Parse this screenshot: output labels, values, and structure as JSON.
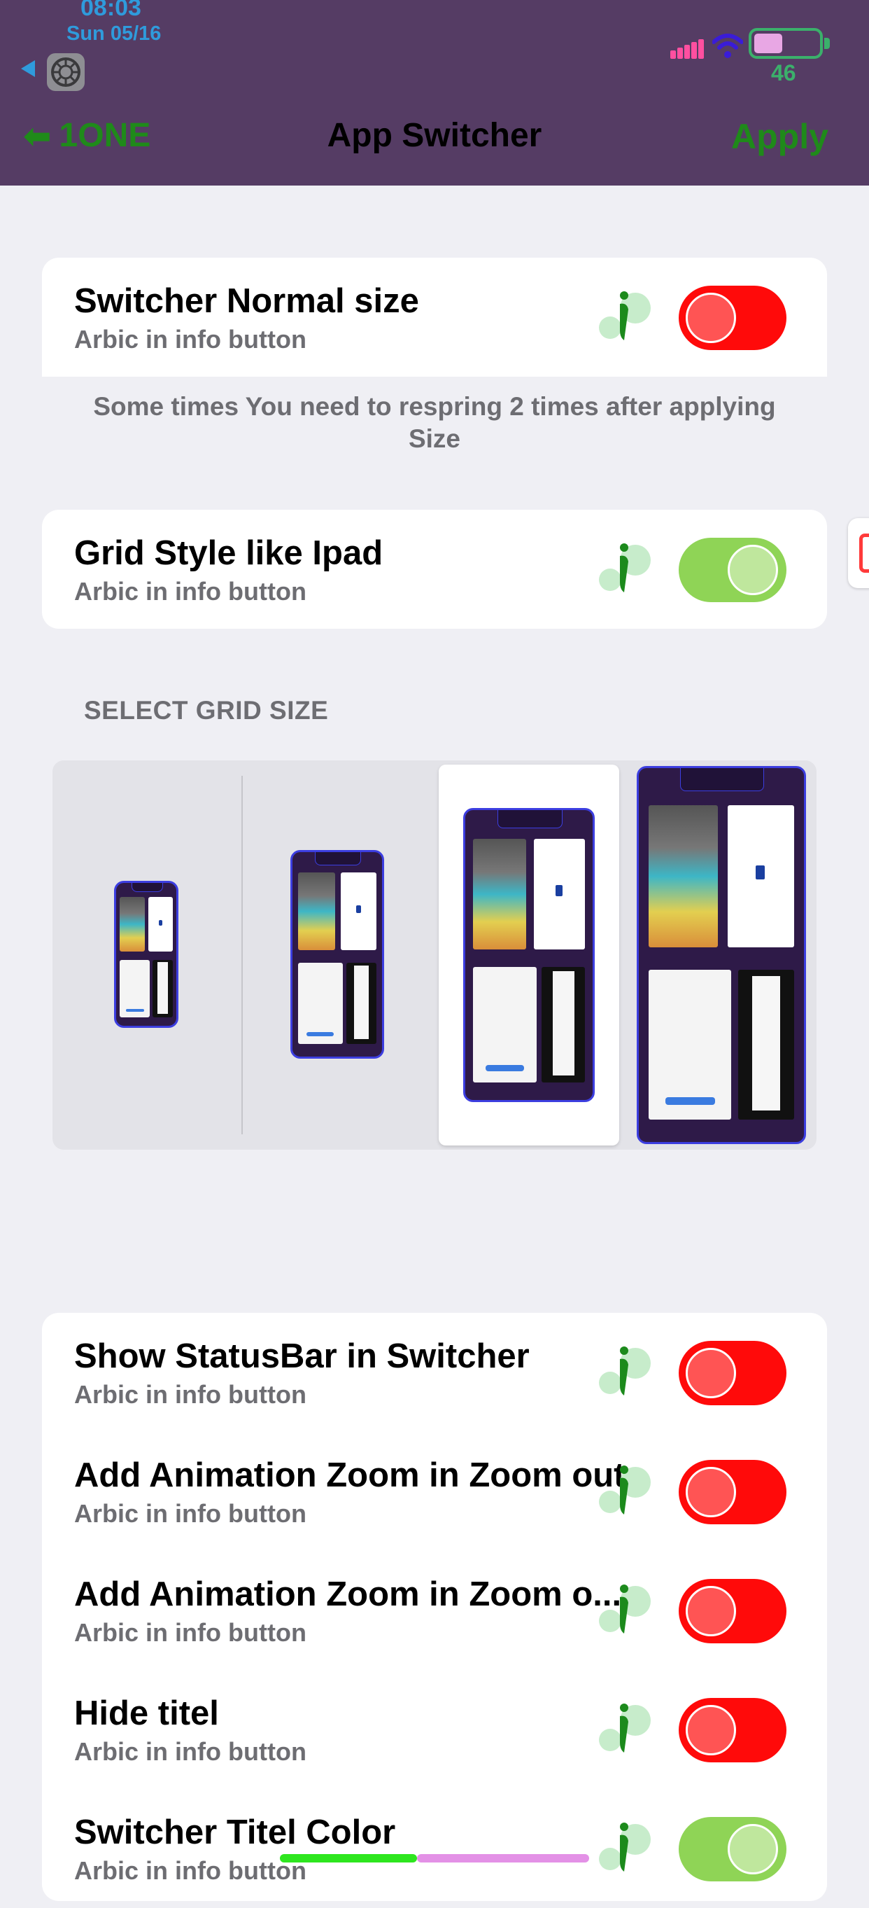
{
  "status_bar": {
    "time": "08:03",
    "date": "Sun 05/16",
    "battery_percent": "46"
  },
  "nav": {
    "back_label": "1ONE",
    "title": "App Switcher",
    "apply_label": "Apply"
  },
  "sections": {
    "size": {
      "title": "Switcher Normal size",
      "subtitle": "Arbic in info button",
      "toggle_on": false,
      "footer": "Some times You need to respring 2 times after applying Size"
    },
    "grid": {
      "title": "Grid Style like Ipad",
      "subtitle": "Arbic in info button",
      "toggle_on": true
    },
    "grid_size": {
      "header": "SELECT GRID SIZE",
      "selected_index": 2,
      "option_count": 4
    },
    "options": [
      {
        "title": "Show StatusBar in Switcher",
        "subtitle": "Arbic in info button",
        "toggle_on": false
      },
      {
        "title": "Add Animation Zoom in Zoom out",
        "subtitle": "Arbic in info button",
        "toggle_on": false
      },
      {
        "title": "Add Animation Zoom in Zoom o...",
        "subtitle": "Arbic in info button",
        "toggle_on": false
      },
      {
        "title": "Hide titel",
        "subtitle": "Arbic in info button",
        "toggle_on": false
      },
      {
        "title": "Switcher Titel Color",
        "subtitle": "Arbic in info button",
        "toggle_on": true
      }
    ]
  },
  "colors": {
    "header_bg": "#553c64",
    "accent_green": "#1f8a1a",
    "toggle_off": "#ff0a0a",
    "toggle_on": "#8fd456"
  },
  "icons": {
    "back": "arrow-left-icon",
    "settings": "gear-icon",
    "info": "info-icon",
    "signal": "signal-icon",
    "wifi": "wifi-icon",
    "battery": "battery-icon"
  }
}
